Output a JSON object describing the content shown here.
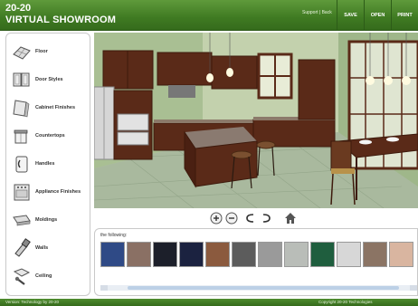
{
  "header": {
    "logo_line1": "20-20",
    "logo_line2": "VIRTUAL SHOWROOM",
    "links": "Support | Back",
    "buttons": [
      "SAVE",
      "OPEN",
      "PRINT"
    ]
  },
  "sidebar": {
    "items": [
      {
        "label": "Floor",
        "icon": "floor-icon"
      },
      {
        "label": "Door Styles",
        "icon": "door-styles-icon"
      },
      {
        "label": "Cabinet Finishes",
        "icon": "cabinet-finishes-icon"
      },
      {
        "label": "Countertops",
        "icon": "countertops-icon"
      },
      {
        "label": "Handles",
        "icon": "handles-icon"
      },
      {
        "label": "Appliance Finishes",
        "icon": "appliance-finishes-icon"
      },
      {
        "label": "Moldings",
        "icon": "moldings-icon"
      },
      {
        "label": "Walls",
        "icon": "walls-icon"
      },
      {
        "label": "Ceiling",
        "icon": "ceiling-icon"
      }
    ]
  },
  "toolbar": {
    "buttons": [
      "zoom-in-icon",
      "zoom-out-icon",
      "rotate-left-icon",
      "rotate-right-icon",
      "home-icon"
    ]
  },
  "swatches": {
    "title": "the following:",
    "colors": [
      "#2f4a86",
      "#8a7064",
      "#1c1f2a",
      "#1b2240",
      "#8b5a3e",
      "#5c5c5c",
      "#9a9a9a",
      "#b9bdb8",
      "#1f5e3e",
      "#d7d7d7",
      "#8b7464",
      "#d9b5a0"
    ]
  },
  "footer": {
    "left": "Version: Technology by 20-20",
    "right": "Copyright 20-20 Technologies"
  },
  "colors": {
    "header_green": "#3f7a22",
    "cabinet_brown": "#5a2a18",
    "floor_green": "#a9b99e"
  }
}
